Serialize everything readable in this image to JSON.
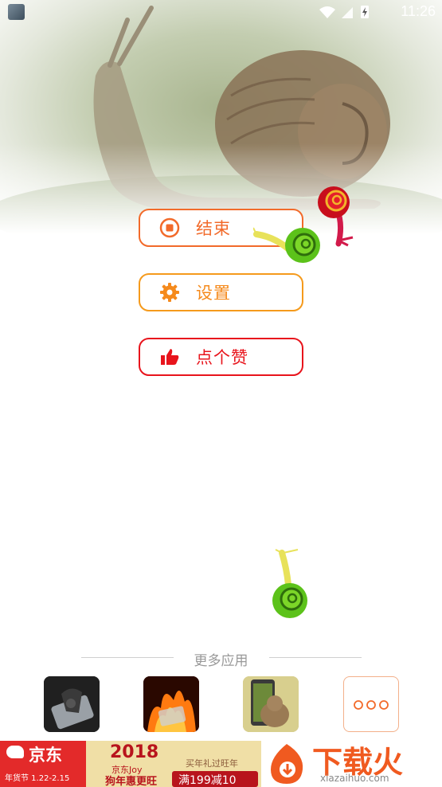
{
  "status_bar": {
    "time": "11:26"
  },
  "buttons": {
    "stop_label": "结束",
    "settings_label": "设置",
    "like_label": "点个赞"
  },
  "more_apps": {
    "title": "更多应用",
    "apps": [
      {
        "icon": "scorpion-phone-app-icon"
      },
      {
        "icon": "fire-phone-app-icon"
      },
      {
        "icon": "cat-phone-app-icon"
      },
      {
        "icon": "more-apps-icon"
      }
    ]
  },
  "ad": {
    "brand": "京东",
    "festival_line": "年货节 1.22-2.15",
    "year": "2018",
    "joy_line": "京东Joy",
    "slogan": "狗年惠更旺",
    "sub_line": "买年礼过旺年",
    "deal": "满199减10",
    "watermark_title": "下载火",
    "watermark_url": "xiazaihuo.com"
  },
  "colors": {
    "stop": "#f26a2a",
    "settings": "#f59a1c",
    "like": "#e8141c",
    "ad_red": "#e32a2a"
  }
}
